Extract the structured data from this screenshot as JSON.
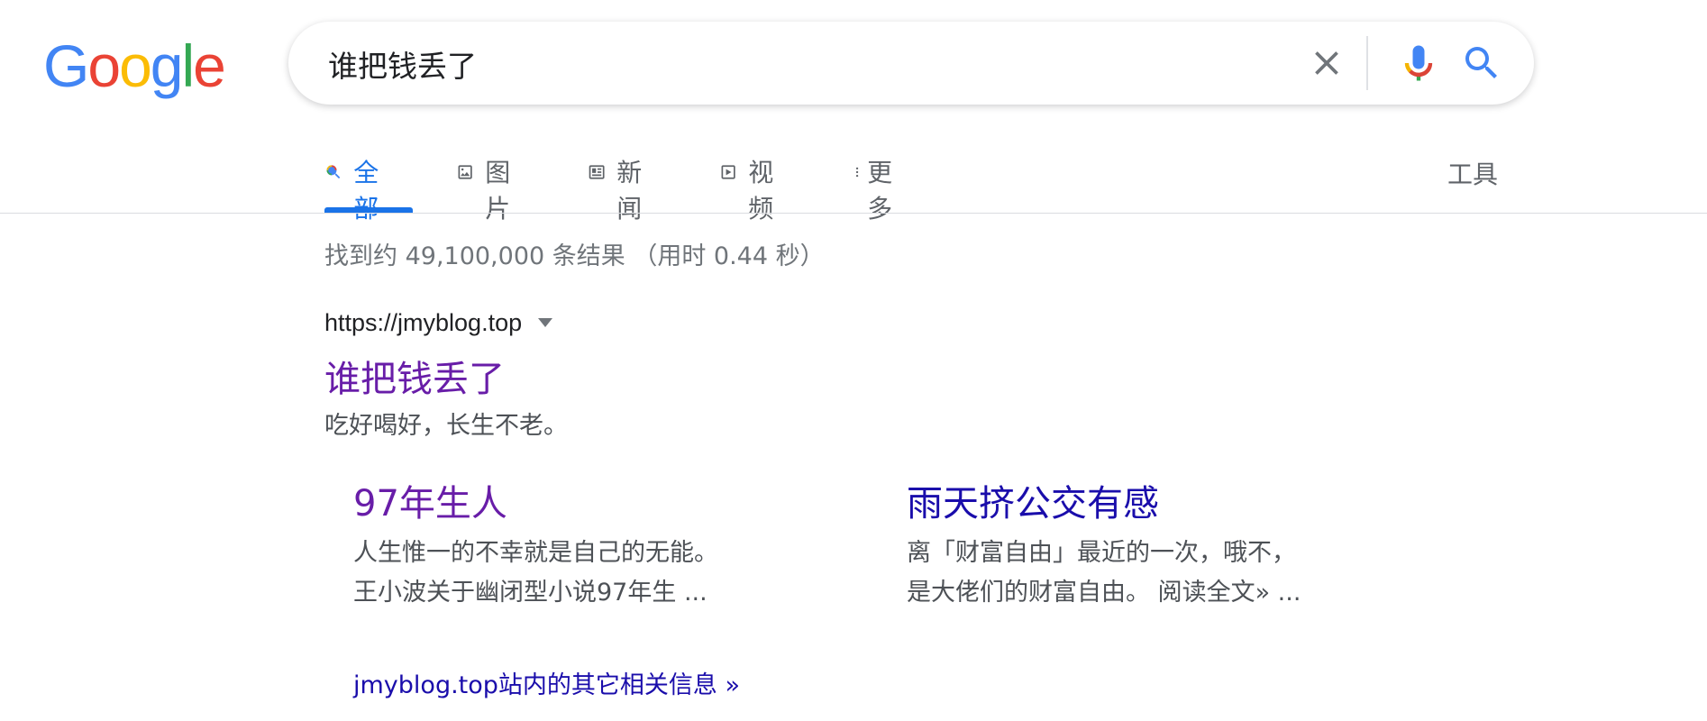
{
  "logo": {
    "letters": [
      "G",
      "o",
      "o",
      "g",
      "l",
      "e"
    ],
    "colors": [
      "#4285F4",
      "#EA4335",
      "#FBBC05",
      "#4285F4",
      "#34A853",
      "#EA4335"
    ]
  },
  "search": {
    "query": "谁把钱丢了",
    "clear_icon": "close-icon",
    "mic_icon": "microphone-icon",
    "search_icon": "search-icon"
  },
  "tabs": [
    {
      "label": "全部",
      "icon": "search-icon",
      "active": true
    },
    {
      "label": "图片",
      "icon": "image-icon"
    },
    {
      "label": "新闻",
      "icon": "news-icon"
    },
    {
      "label": "视频",
      "icon": "video-icon"
    },
    {
      "label": "更多",
      "icon": "more-vert-icon"
    }
  ],
  "tools_label": "工具",
  "stats": "找到约 49,100,000 条结果 （用时 0.44 秒）",
  "result": {
    "url": "https://jmyblog.top",
    "title": "谁把钱丢了",
    "snippet": "吃好喝好，长生不老。",
    "sitelinks": [
      {
        "title": "97年生人",
        "snippet": "人生惟一的不幸就是自己的无能。 王小波关于幽闭型小说97年生 ...",
        "color": "#681da8"
      },
      {
        "title": "雨天挤公交有感",
        "snippet": "离「财富自由」最近的一次，哦不，是大佬们的财富自由。 阅读全文» ...",
        "color": "#1a0dab"
      }
    ],
    "more_link": "jmyblog.top站内的其它相关信息 »"
  },
  "colors": {
    "accent": "#1a73e8",
    "visited": "#681da8",
    "link": "#1a0dab"
  }
}
